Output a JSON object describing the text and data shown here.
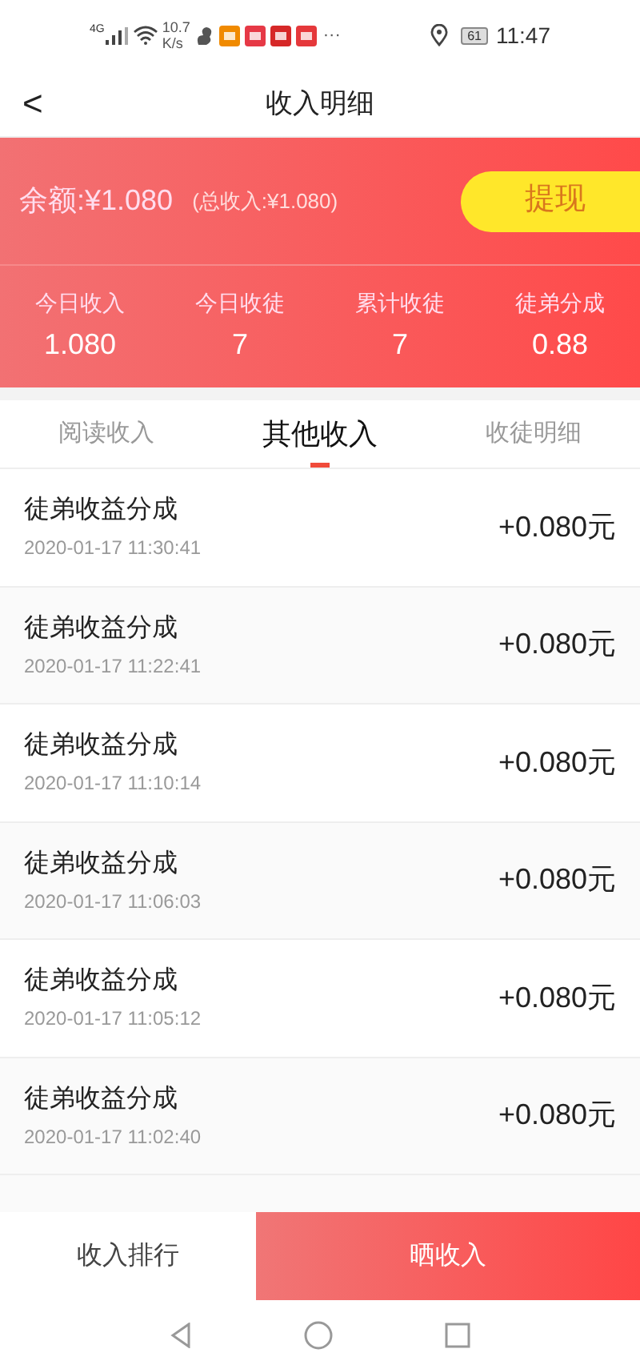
{
  "status_bar": {
    "network": "4G",
    "speed": "10.7",
    "speed_unit": "K/s",
    "more": "···",
    "battery": "61",
    "time": "11:47"
  },
  "header": {
    "back": "<",
    "title": "收入明细"
  },
  "balance": {
    "label": "余额:¥1.080",
    "total": "(总收入:¥1.080)",
    "withdraw": "提现"
  },
  "stats": [
    {
      "label": "今日收入",
      "value": "1.080"
    },
    {
      "label": "今日收徒",
      "value": "7"
    },
    {
      "label": "累计收徒",
      "value": "7"
    },
    {
      "label": "徒弟分成",
      "value": "0.88"
    }
  ],
  "tabs": [
    {
      "label": "阅读收入",
      "selected": false
    },
    {
      "label": "其他收入",
      "selected": true
    },
    {
      "label": "收徒明细",
      "selected": false
    }
  ],
  "records": [
    {
      "title": "徒弟收益分成",
      "time": "2020-01-17 11:30:41",
      "amount": "+0.080元"
    },
    {
      "title": "徒弟收益分成",
      "time": "2020-01-17 11:22:41",
      "amount": "+0.080元"
    },
    {
      "title": "徒弟收益分成",
      "time": "2020-01-17 11:10:14",
      "amount": "+0.080元"
    },
    {
      "title": "徒弟收益分成",
      "time": "2020-01-17 11:06:03",
      "amount": "+0.080元"
    },
    {
      "title": "徒弟收益分成",
      "time": "2020-01-17 11:05:12",
      "amount": "+0.080元"
    },
    {
      "title": "徒弟收益分成",
      "time": "2020-01-17 11:02:40",
      "amount": "+0.080元"
    }
  ],
  "bottom_bar": [
    {
      "label": "收入排行",
      "kind": "plain"
    },
    {
      "label": "晒收入",
      "kind": "primary"
    }
  ]
}
